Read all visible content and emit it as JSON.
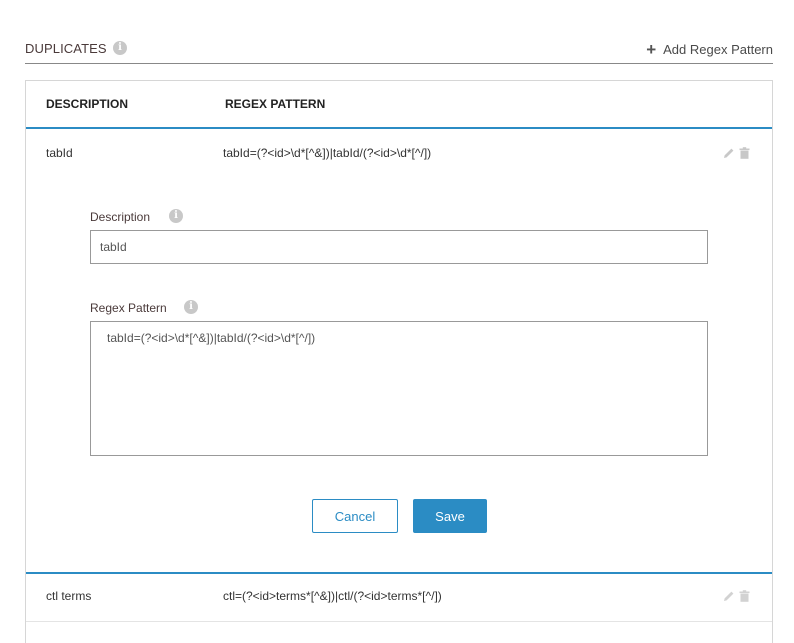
{
  "section": {
    "title": "DUPLICATES",
    "add_label": "Add Regex Pattern"
  },
  "table": {
    "columns": [
      "DESCRIPTION",
      "REGEX PATTERN"
    ],
    "rows": [
      {
        "description": "tabId",
        "pattern": "tabId=(?<id>\\d*[^&])|tabId/(?<id>\\d*[^/])"
      },
      {
        "description": "ctl terms",
        "pattern": "ctl=(?<id>terms*[^&])|ctl/(?<id>terms*[^/])"
      }
    ]
  },
  "edit_form": {
    "description_label": "Description",
    "description_value": "tabId",
    "pattern_label": "Regex Pattern",
    "pattern_value": "tabId=(?<id>\\d*[^&])|tabId/(?<id>\\d*[^/])",
    "cancel_label": "Cancel",
    "save_label": "Save"
  },
  "colors": {
    "accent": "#2b8cc4",
    "icon_gray": "#c8c8c8"
  }
}
